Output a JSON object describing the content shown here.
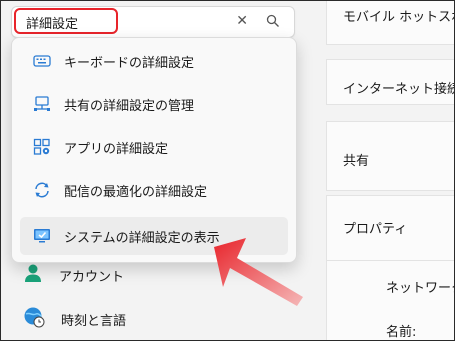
{
  "search": {
    "value": "詳細設定"
  },
  "suggestions": [
    {
      "label": "キーボードの詳細設定",
      "icon": "keyboard-icon"
    },
    {
      "label": "共有の詳細設定の管理",
      "icon": "network-share-icon"
    },
    {
      "label": "アプリの詳細設定",
      "icon": "apps-settings-icon"
    },
    {
      "label": "配信の最適化の詳細設定",
      "icon": "sync-icon"
    },
    {
      "label": "システムの詳細設定の表示",
      "icon": "system-monitor-icon"
    }
  ],
  "nav": {
    "account": {
      "label": "アカウント",
      "icon": "account-icon"
    },
    "time_language": {
      "label": "時刻と言語",
      "icon": "globe-clock-icon"
    }
  },
  "right_panel": {
    "mobile_hotspot": "モバイル ホットスポット",
    "internet_connection": "インターネット接続を共",
    "sharing": "共有",
    "properties": "プロパティ",
    "network_line": "ネットワークの",
    "name_label": "名前:"
  },
  "colors": {
    "accent": "#0067c0",
    "highlight_red": "#e8242b"
  }
}
